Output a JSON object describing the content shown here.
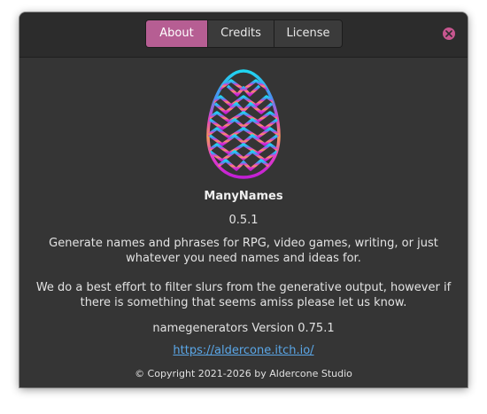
{
  "tabs": [
    {
      "label": "About",
      "active": true
    },
    {
      "label": "Credits",
      "active": false
    },
    {
      "label": "License",
      "active": false
    }
  ],
  "close_icon": "close-icon",
  "logo_icon": "egg-dragon-scale-icon",
  "app": {
    "name": "ManyNames",
    "version": "0.5.1",
    "description_1": "Generate names and phrases for RPG, video games, writing, or just whatever you need names and ideas for.",
    "description_2": "We do a best effort to filter slurs from the generative output, however if there is something that seems amiss please let us know.",
    "library_version": "namegenerators Version 0.75.1",
    "website": "https://aldercone.itch.io/",
    "copyright": "© Copyright 2021-2026 by Aldercone Studio"
  },
  "colors": {
    "accent": "#b65e93",
    "close": "#c7568f",
    "link": "#5aa7e8",
    "background": "#353535",
    "titlebar": "#2c2c2c"
  }
}
